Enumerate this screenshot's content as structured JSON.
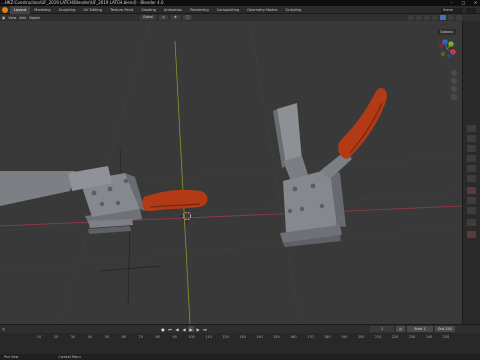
{
  "window": {
    "title": "...HKZ-Construction\\UF_2019 LATCH\\Blender\\UF_2019 LATCH.blend] - Blender 4.0",
    "controls": [
      "minimize-icon",
      "maximize-icon",
      "close-icon"
    ]
  },
  "workspaces": {
    "tabs": [
      "Layout",
      "Modeling",
      "Sculpting",
      "UV Editing",
      "Texture Paint",
      "Shading",
      "Animation",
      "Rendering",
      "Compositing",
      "Geometry Nodes",
      "Scripting"
    ],
    "active": "Layout",
    "scene": "Scene",
    "view_layer": "ViewLayer"
  },
  "header": {
    "left": [
      "View",
      "Add",
      "Object"
    ],
    "transform_orientation": "Global",
    "options_label": "Options"
  },
  "viewport": {
    "grid_color": "#404040",
    "x_axis_color": "#9a3b46",
    "y_axis_color": "#7b9a2a",
    "handle_color": "#b23a16",
    "metal_color": "#8a8d92",
    "gizmo": {
      "x": "X",
      "y": "Y",
      "z": "Z"
    }
  },
  "timeline": {
    "left": [
      "Playback",
      "Keying",
      "View",
      "Marker"
    ],
    "current_frame": "1",
    "start_label": "Start",
    "start_value": "1",
    "end_label": "End",
    "end_value": "250",
    "ticks": [
      "0",
      "10",
      "20",
      "30",
      "40",
      "50",
      "60",
      "70",
      "80",
      "90",
      "100",
      "110",
      "120",
      "130",
      "140",
      "150",
      "160",
      "170",
      "180",
      "190",
      "200",
      "210",
      "220",
      "230",
      "240",
      "250"
    ]
  },
  "status": {
    "left": "Pan View",
    "middle": "Context Menu"
  },
  "colors": {
    "accent": "#4772b3",
    "blender_orange": "#e87d0d"
  }
}
